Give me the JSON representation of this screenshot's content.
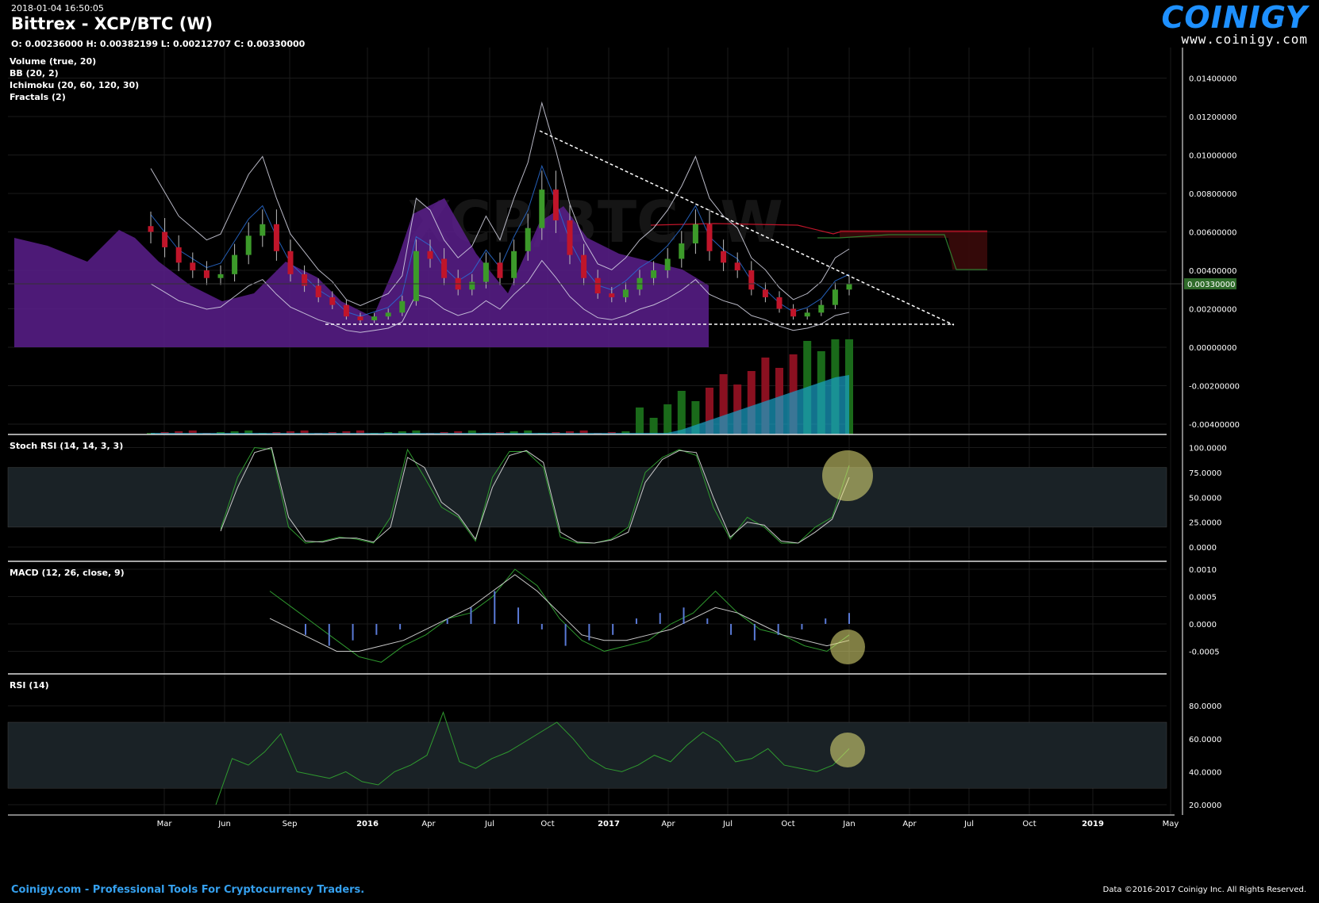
{
  "header": {
    "timestamp": "2018-01-04 16:50:05",
    "title": "Bittrex - XCP/BTC (W)",
    "ohlc": "O: 0.00236000 H: 0.00382199 L: 0.00212707 C: 0.00330000"
  },
  "logo": {
    "name": "COINIGY",
    "url": "www.coinigy.com"
  },
  "watermark": "XCP/BTC, W",
  "indicators": [
    "Volume (true, 20)",
    "BB (20, 2)",
    "Ichimoku (20, 60, 120, 30)",
    "Fractals (2)"
  ],
  "panes": {
    "stoch_label": "Stoch RSI (14, 14, 3, 3)",
    "macd_label": "MACD (12, 26, close, 9)",
    "rsi_label": "RSI (14)"
  },
  "footer": {
    "left": "Coinigy.com - Professional Tools For Cryptocurrency Traders.",
    "right": "Data ©2016-2017 Coinigy Inc. All Rights Reserved."
  },
  "colors": {
    "background": "#000000",
    "candle_up": "#3c9a2a",
    "candle_down": "#c0152a",
    "cloud": "#5b1f8c",
    "volume_ma": "#1aa3c9",
    "oscillator": "#2f9a2f",
    "price_tag": "#2f6b2a",
    "highlight": "#e8e47a"
  },
  "chart_data": [
    {
      "type": "candlestick",
      "title": "Bittrex - XCP/BTC (W)",
      "pair": "XCP/BTC",
      "timeframe": "W",
      "x_tick_labels": [
        "Mar",
        "Jun",
        "Sep",
        "2016",
        "Apr",
        "Jul",
        "Oct",
        "2017",
        "Apr",
        "Jul",
        "Oct",
        "Jan",
        "Apr",
        "Jul",
        "Oct",
        "2019",
        "May"
      ],
      "y_tick_labels": [
        "0.01400000",
        "0.01200000",
        "0.01000000",
        "0.00800000",
        "0.00600000",
        "0.00400000",
        "0.00200000",
        "0.00000000",
        "-0.00200000",
        "-0.00400000"
      ],
      "ylim": [
        -0.0045,
        0.0155
      ],
      "last_price": "0.00330000",
      "close_series": [
        0.006,
        0.0052,
        0.0044,
        0.004,
        0.0036,
        0.0038,
        0.0048,
        0.0058,
        0.0064,
        0.005,
        0.0038,
        0.0032,
        0.0026,
        0.0022,
        0.0016,
        0.0014,
        0.0016,
        0.0018,
        0.0024,
        0.005,
        0.0046,
        0.0036,
        0.003,
        0.0034,
        0.0044,
        0.0036,
        0.005,
        0.0062,
        0.0082,
        0.0066,
        0.0048,
        0.0036,
        0.0028,
        0.0026,
        0.003,
        0.0036,
        0.004,
        0.0046,
        0.0054,
        0.0064,
        0.005,
        0.0044,
        0.004,
        0.003,
        0.0026,
        0.002,
        0.0016,
        0.0018,
        0.0022,
        0.003,
        0.0033
      ],
      "trendlines": [
        {
          "name": "descending resistance",
          "from": [
            "2016-09",
            0.0113
          ],
          "to": [
            "2018-05",
            0.0011
          ]
        },
        {
          "name": "horizontal support",
          "value": 0.0012
        }
      ],
      "volume_note": "volume bars rise sharply from 2017-04 onward"
    },
    {
      "type": "line",
      "title": "Stoch RSI (14, 14, 3, 3)",
      "y_tick_labels": [
        "100.0000",
        "75.0000",
        "50.0000",
        "25.0000",
        "0.0000"
      ],
      "ylim": [
        -5,
        105
      ],
      "band": [
        20,
        80
      ],
      "series": [
        {
          "name": "K",
          "values": [
            18,
            70,
            100,
            98,
            20,
            4,
            6,
            10,
            8,
            4,
            30,
            98,
            70,
            40,
            30,
            6,
            70,
            96,
            96,
            80,
            10,
            4,
            4,
            8,
            20,
            75,
            90,
            98,
            92,
            40,
            8,
            30,
            20,
            4,
            4,
            20,
            30,
            82
          ]
        },
        {
          "name": "D",
          "values": [
            16,
            60,
            95,
            100,
            30,
            6,
            5,
            9,
            9,
            5,
            20,
            90,
            80,
            45,
            32,
            8,
            60,
            92,
            97,
            85,
            15,
            5,
            4,
            7,
            15,
            65,
            88,
            97,
            95,
            50,
            10,
            25,
            22,
            6,
            4,
            15,
            28,
            70
          ]
        }
      ],
      "highlight": "latest value"
    },
    {
      "type": "line",
      "title": "MACD (12, 26, close, 9)",
      "y_tick_labels": [
        "0.0010",
        "0.0005",
        "0.0000",
        "-0.0005"
      ],
      "ylim": [
        -0.00078,
        0.00118
      ],
      "series": [
        {
          "name": "MACD",
          "values": [
            0.0006,
            0.0003,
            0.0,
            -0.0003,
            -0.0006,
            -0.0007,
            -0.0004,
            -0.0002,
            0.0001,
            0.0002,
            0.0005,
            0.001,
            0.0007,
            0.0001,
            -0.0003,
            -0.0005,
            -0.0004,
            -0.0003,
            0.0,
            0.0002,
            0.0006,
            0.0002,
            -0.0001,
            -0.0002,
            -0.0004,
            -0.0005,
            -0.0002
          ]
        },
        {
          "name": "Signal",
          "values": [
            0.0001,
            -0.0001,
            -0.0003,
            -0.0005,
            -0.0005,
            -0.0004,
            -0.0003,
            -0.0001,
            0.0001,
            0.0003,
            0.0006,
            0.0009,
            0.0006,
            0.0002,
            -0.0002,
            -0.0003,
            -0.0003,
            -0.0002,
            -0.0001,
            0.0001,
            0.0003,
            0.0002,
            0.0,
            -0.0002,
            -0.0003,
            -0.0004,
            -0.0003
          ]
        },
        {
          "name": "Histogram",
          "values": [
            -0.0002,
            -0.0004,
            -0.0003,
            -0.0002,
            -0.0001,
            0.0,
            0.0001,
            0.0003,
            0.0006,
            0.0003,
            -0.0001,
            -0.0004,
            -0.0003,
            -0.0002,
            0.0001,
            0.0002,
            0.0003,
            0.0001,
            -0.0002,
            -0.0003,
            -0.0002,
            -0.0001,
            0.0001,
            0.0002
          ]
        }
      ],
      "highlight": "latest value"
    },
    {
      "type": "line",
      "title": "RSI (14)",
      "y_tick_labels": [
        "80.0000",
        "60.0000",
        "40.0000",
        "20.0000"
      ],
      "ylim": [
        14,
        90
      ],
      "band": [
        30,
        70
      ],
      "series": [
        {
          "name": "RSI",
          "values": [
            20,
            48,
            44,
            52,
            63,
            40,
            38,
            36,
            40,
            34,
            32,
            40,
            44,
            50,
            76,
            46,
            42,
            48,
            52,
            58,
            64,
            70,
            60,
            48,
            42,
            40,
            44,
            50,
            46,
            56,
            64,
            58,
            46,
            48,
            54,
            44,
            42,
            40,
            44,
            54
          ]
        }
      ],
      "highlight": "latest value"
    }
  ]
}
